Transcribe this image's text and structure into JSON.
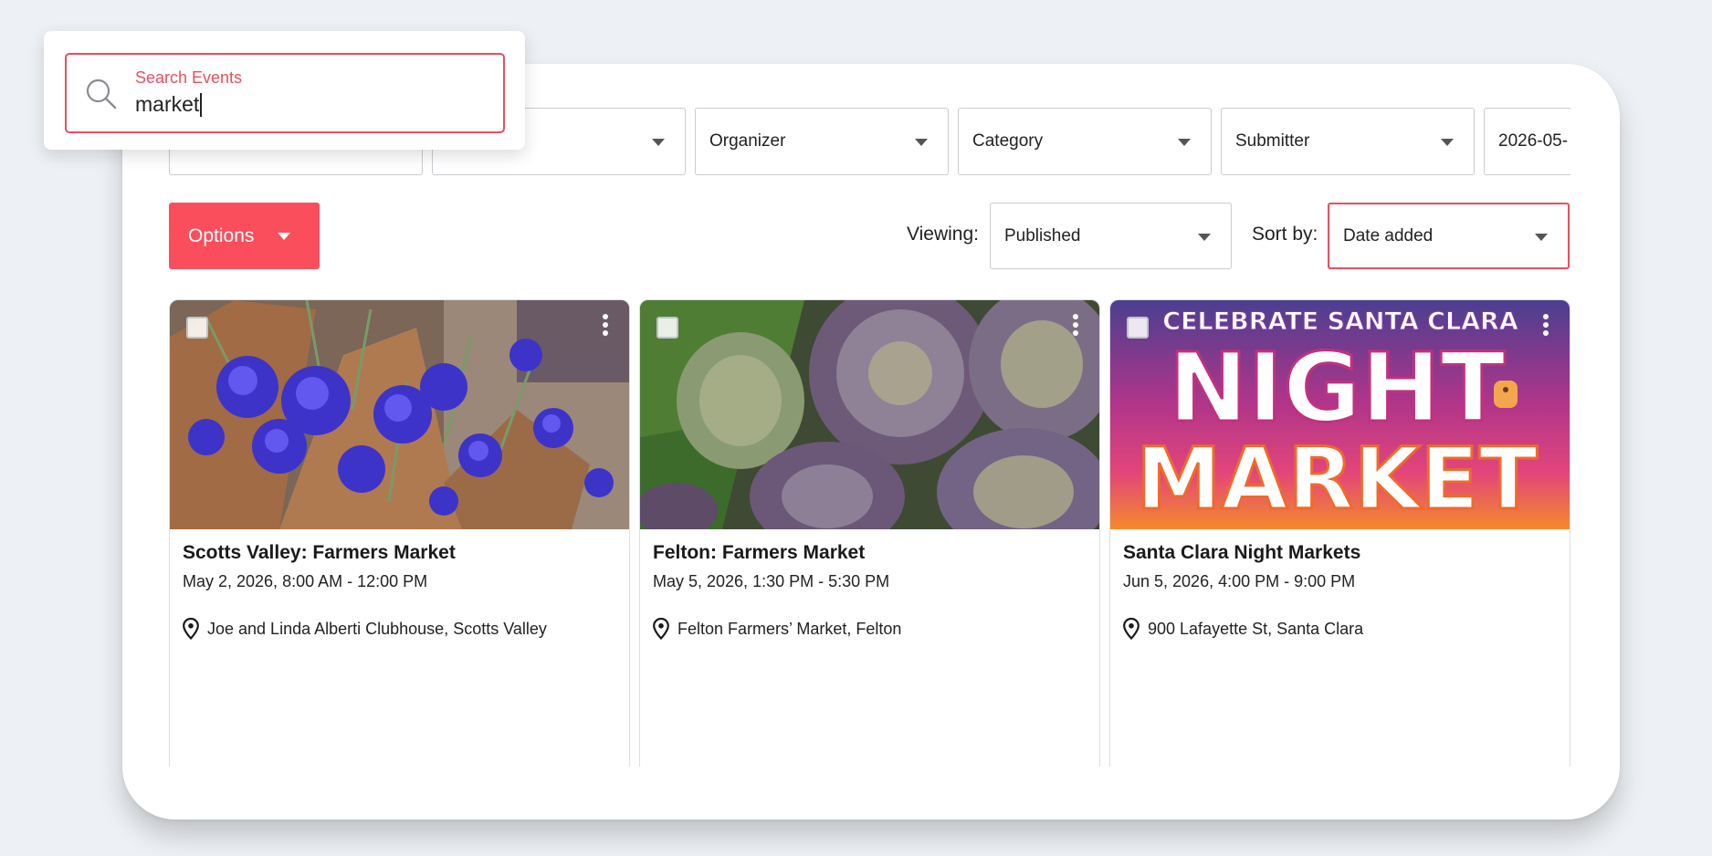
{
  "search": {
    "label": "Search Events",
    "value": "market",
    "icon": "search-icon"
  },
  "filters": {
    "organizer": "Organizer",
    "category": "Category",
    "submitter": "Submitter",
    "date": "2026-05-"
  },
  "toolbar": {
    "options_label": "Options",
    "viewing_label": "Viewing:",
    "viewing_value": "Published",
    "sort_label": "Sort by:",
    "sort_value": "Date added"
  },
  "events": [
    {
      "title": "Scotts Valley: Farmers Market",
      "date": "May 2, 2026, 8:00 AM - 12:00 PM",
      "location": "Joe and Linda Alberti Clubhouse, Scotts Valley"
    },
    {
      "title": "Felton: Farmers Market",
      "date": "May 5, 2026, 1:30 PM - 5:30 PM",
      "location": "Felton Farmers’ Market, Felton"
    },
    {
      "title": "Santa Clara Night Markets",
      "date": "Jun 5, 2026, 4:00 PM - 9:00 PM",
      "location": "900 Lafayette St, Santa Clara",
      "poster": {
        "line1": "CELEBRATE SANTA CLARA",
        "line2": "NIGHT",
        "line3": "MARKET"
      }
    }
  ],
  "colors": {
    "accent": "#fb4e5c",
    "highlight_border": "#ec4d5a",
    "background": "#edf0f4"
  }
}
